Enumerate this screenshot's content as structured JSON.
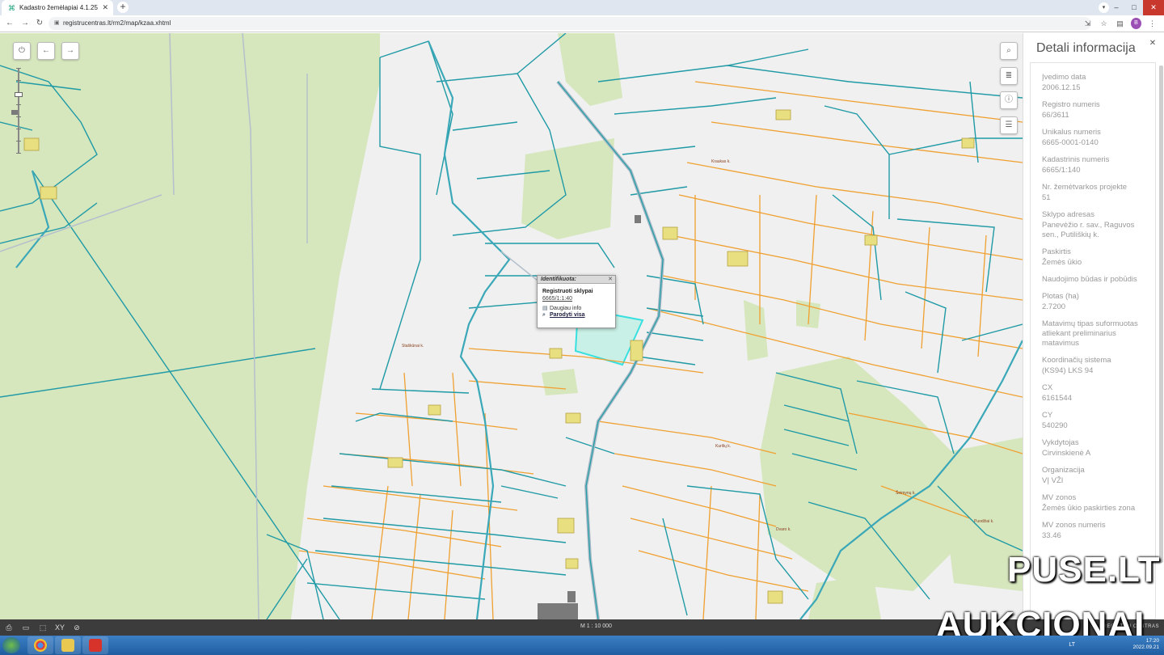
{
  "browser": {
    "tab_title": "Kadastro žemėlapiai 4.1.25",
    "url": "registrucentras.lt/rm2/map/kzaa.xhtml",
    "profile_initial": "B"
  },
  "map": {
    "popup": {
      "header": "Identifikuota:",
      "title": "Registruoti sklypai",
      "parcel_id": "6665/1:1:40",
      "link_more": "Daugiau info",
      "link_show_all": "Parodyti visa"
    },
    "scale": "M 1 : 10 000",
    "brand": "REGISTRŲ CENTRAS",
    "place_labels": {
      "l1": "Kraukas k.",
      "l2": "Staškūnai k.",
      "l3": "Kurilių k.",
      "l4": "Puodžiai k.",
      "l5": "Šeimynų k.",
      "l6": "Dvaro k."
    }
  },
  "detail_panel": {
    "title": "Detali informacija",
    "fields": [
      {
        "label": "Įvedimo data",
        "value": "2006.12.15"
      },
      {
        "label": "Registro numeris",
        "value": "66/3611"
      },
      {
        "label": "Unikalus numeris",
        "value": "6665-0001-0140"
      },
      {
        "label": "Kadastrinis numeris",
        "value": "6665/1:140"
      },
      {
        "label": "Nr. žemėtvarkos projekte",
        "value": "51"
      },
      {
        "label": "Sklypo adresas",
        "value": "Panevėžio r. sav., Raguvos sen., Putiliškių k."
      },
      {
        "label": "Paskirtis",
        "value": "Žemės ūkio"
      },
      {
        "label": "Naudojimo būdas ir pobūdis",
        "value": ""
      },
      {
        "label": "Plotas (ha)",
        "value": "2.7200"
      },
      {
        "label": "Matavimų tipas suformuotas atliekant preliminarius matavimus",
        "value": ""
      },
      {
        "label": "Koordinačių sistema",
        "value": "(KS94) LKS 94"
      },
      {
        "label": "CX",
        "value": "6161544"
      },
      {
        "label": "CY",
        "value": "540290"
      },
      {
        "label": "Vykdytojas",
        "value": "Cirvinskienė A"
      },
      {
        "label": "Organizacija",
        "value": "VĮ VŽI"
      },
      {
        "label": "MV zonos",
        "value": "Žemės ūkio paskirties zona"
      },
      {
        "label": "MV zonos numeris",
        "value": "33.46"
      }
    ]
  },
  "watermark": {
    "line1": "PUSE.LT",
    "line2": "AUKCIONAI"
  },
  "taskbar": {
    "lang": "LT",
    "time": "17:20",
    "date": "2022.09.21"
  },
  "colors": {
    "parcel_blue": "#1f9aa6",
    "boundary_orange": "#f0a030",
    "forest_green": "#d6e6bd",
    "selected_parcel": "#8ff0e0",
    "road_gray": "#a6b8c6"
  }
}
